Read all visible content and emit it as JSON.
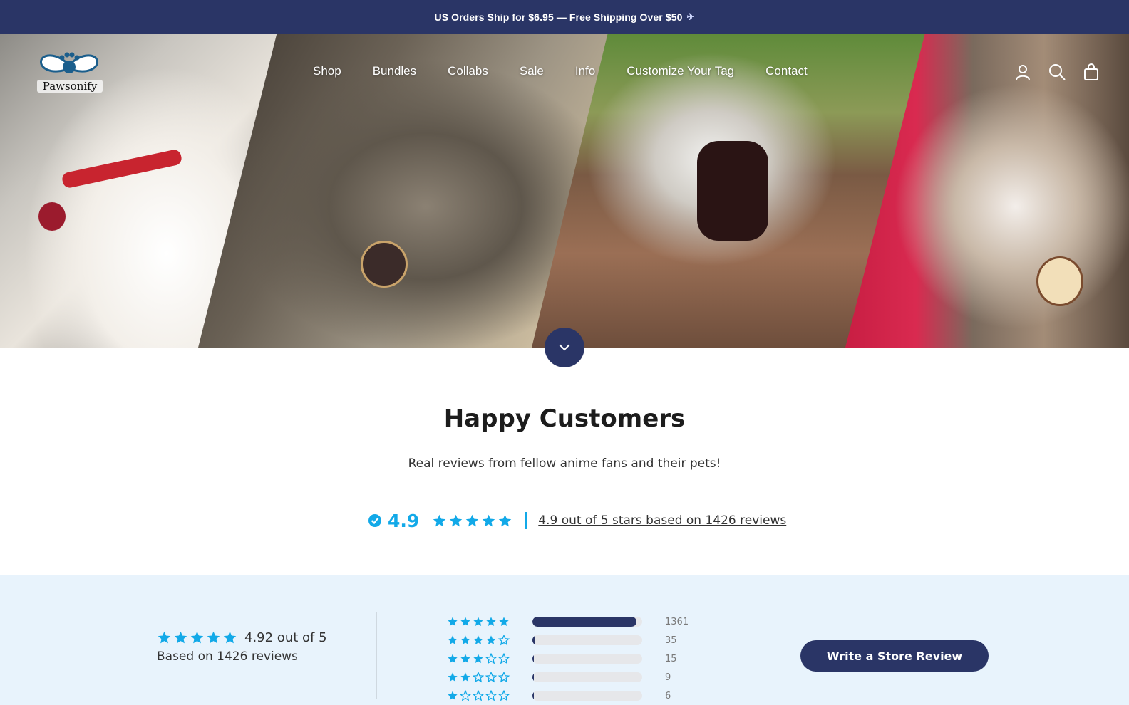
{
  "announcement": {
    "text": "US Orders Ship for $6.95 — Free Shipping Over $50",
    "icon": "airplane-icon"
  },
  "brand": {
    "name": "Pawsonify",
    "logo_icon": "paw-bow-logo",
    "primary": "#2a3566",
    "accent": "#12a9e8"
  },
  "nav": {
    "items": [
      {
        "label": "Shop"
      },
      {
        "label": "Bundles"
      },
      {
        "label": "Collabs"
      },
      {
        "label": "Sale"
      },
      {
        "label": "Info"
      },
      {
        "label": "Customize Your Tag"
      },
      {
        "label": "Contact"
      }
    ],
    "icons": [
      "account-icon",
      "search-icon",
      "cart-icon"
    ]
  },
  "hero": {
    "scroll_icon": "chevron-down-icon"
  },
  "customers": {
    "title": "Happy Customers",
    "subtitle": "Real reviews from fellow anime fans and their pets!",
    "rating": "4.9",
    "rating_summary": "4.9 out of 5 stars based on 1426 reviews"
  },
  "reviews": {
    "average_text": "4.92 out of 5",
    "based_on": "Based on 1426 reviews",
    "histogram": [
      {
        "stars": 5,
        "count": "1361",
        "fraction": 0.95
      },
      {
        "stars": 4,
        "count": "35",
        "fraction": 0.018
      },
      {
        "stars": 3,
        "count": "15",
        "fraction": 0.011
      },
      {
        "stars": 2,
        "count": "9",
        "fraction": 0.011
      },
      {
        "stars": 1,
        "count": "6",
        "fraction": 0.01
      }
    ],
    "write_button": "Write a Store Review"
  }
}
